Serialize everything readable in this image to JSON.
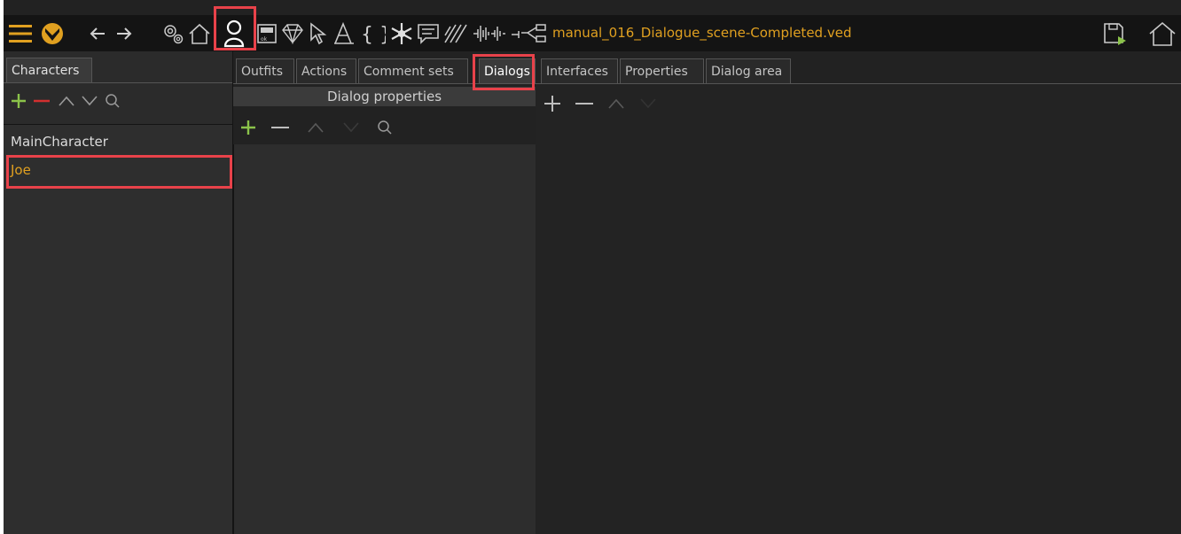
{
  "toolbar": {
    "project_title": "manual_016_Dialogue_scene-Completed.ved",
    "icons": [
      "menu-icon",
      "logo-icon",
      "back-arrow-icon",
      "forward-arrow-icon",
      "gear-icon",
      "home-icon",
      "character-icon",
      "outfit-icon",
      "diamond-icon",
      "cursor-icon",
      "font-icon",
      "braces-icon",
      "snowflake-icon",
      "comment-icon",
      "hatch-icon",
      "audio-icon",
      "share-icon",
      "save-icon",
      "home-outline-icon"
    ]
  },
  "left": {
    "tab_label": "Characters",
    "items": [
      "MainCharacter",
      "Joe"
    ],
    "selected": "Joe"
  },
  "tabs": [
    "Outfits",
    "Actions",
    "Comment sets",
    "Dialogs",
    "Interfaces",
    "Properties",
    "Dialog area"
  ],
  "active_tab": "Dialogs",
  "dialog_props": {
    "header": "Dialog properties"
  },
  "colors": {
    "accent": "#e0a020",
    "add_green": "#8bc34a",
    "remove_red": "#d32f2f",
    "highlight_box": "#e8424a"
  }
}
